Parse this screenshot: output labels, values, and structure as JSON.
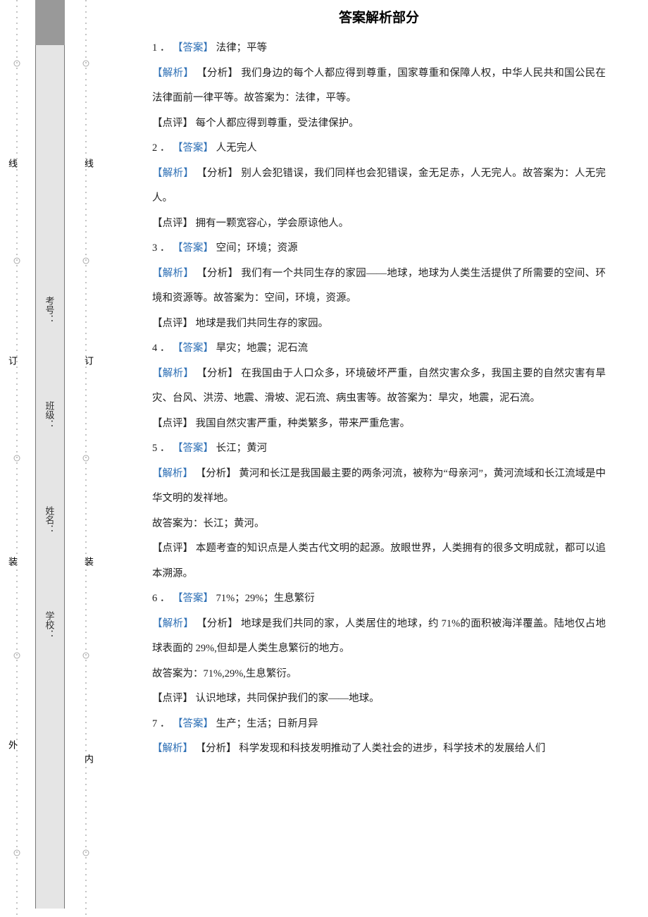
{
  "page_title": "答案解析部分",
  "binding_outer_text": "外",
  "binding_inner_text": "内",
  "binding_seal_chars": [
    "线",
    "订",
    "装"
  ],
  "form_labels": [
    "考号：",
    "班级：",
    "姓名：",
    "学校："
  ],
  "tags": {
    "answer": "【答案】",
    "analysis": "【解析】",
    "fenxi": "【分析】",
    "comment": "【点评】"
  },
  "items": [
    {
      "num": "1 ．",
      "answer": "法律；平等",
      "analysis": "我们身边的每个人都应得到尊重，国家尊重和保障人权，中华人民共和国公民在法律面前一律平等。故答案为：法律，平等。",
      "comment": "每个人都应得到尊重，受法律保护。"
    },
    {
      "num": "2 ．",
      "answer": "人无完人",
      "analysis": "别人会犯错误，我们同样也会犯错误，金无足赤，人无完人。故答案为：人无完人。",
      "comment": "拥有一颗宽容心，学会原谅他人。"
    },
    {
      "num": "3 ．",
      "answer": "空间；环境；资源",
      "analysis": "我们有一个共同生存的家园——地球，地球为人类生活提供了所需要的空间、环境和资源等。故答案为：空间，环境，资源。",
      "comment": "地球是我们共同生存的家园。"
    },
    {
      "num": "4 ．",
      "answer": "旱灾；地震；泥石流",
      "analysis": "在我国由于人口众多，环境破坏严重，自然灾害众多，我国主要的自然灾害有旱灾、台风、洪涝、地震、滑坡、泥石流、病虫害等。故答案为：旱灾，地震，泥石流。",
      "comment": "我国自然灾害严重，种类繁多，带来严重危害。"
    },
    {
      "num": "5 ．",
      "answer": "长江；黄河",
      "analysis": "黄河和长江是我国最主要的两条河流，被称为“母亲河”，黄河流域和长江流域是中华文明的发祥地。",
      "analysis_tail": "故答案为：长江；黄河。",
      "comment": "本题考查的知识点是人类古代文明的起源。放眼世界，人类拥有的很多文明成就，都可以追本溯源。"
    },
    {
      "num": "6 ．",
      "answer": "71%；29%；生息繁衍",
      "analysis": "地球是我们共同的家，人类居住的地球，约 71%的面积被海洋覆盖。陆地仅占地球表面的 29%,但却是人类生息繁衍的地方。",
      "analysis_tail": "故答案为：71%,29%,生息繁衍。",
      "comment": "认识地球，共同保护我们的家——地球。"
    },
    {
      "num": "7 ．",
      "answer": "生产；生活；日新月异",
      "analysis": "科学发现和科技发明推动了人类社会的进步，科学技术的发展给人们"
    }
  ]
}
